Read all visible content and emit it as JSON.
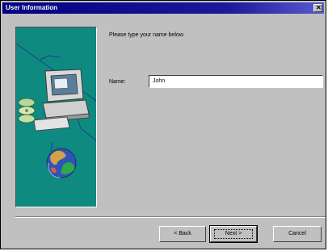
{
  "window": {
    "title": "User Information"
  },
  "main": {
    "prompt": "Please type your name below."
  },
  "form": {
    "name_label": "Name:",
    "name_value": "John"
  },
  "buttons": {
    "back": "< Back",
    "next": "Next >",
    "cancel": "Cancel"
  },
  "colors": {
    "panel": "#0f8a80",
    "titlebar": "#000080",
    "face": "#c0c0c0"
  },
  "icons": {
    "close": "close-icon",
    "computer": "computer-icon",
    "globe": "globe-icon",
    "disks": "disks-icon"
  }
}
